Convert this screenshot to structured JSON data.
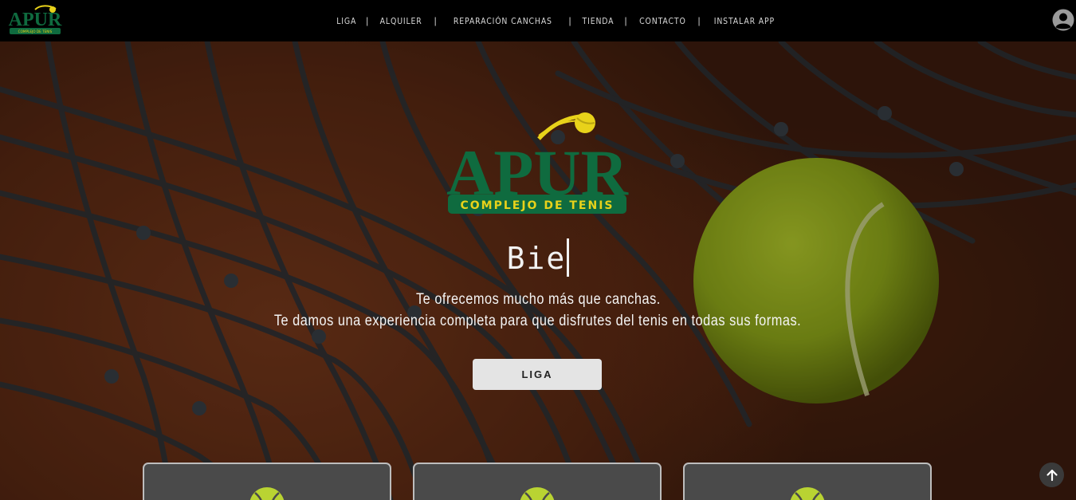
{
  "header": {
    "logo_text": "APUR",
    "logo_subtext": "COMPLEJO DE TENIS",
    "nav": [
      {
        "label": "LIGA"
      },
      {
        "label": "ALQUILER"
      },
      {
        "label": "REPARACIÓN CANCHAS"
      },
      {
        "label": "TIENDA"
      },
      {
        "label": "CONTACTO"
      },
      {
        "label": "INSTALAR APP"
      }
    ],
    "separator": "|",
    "user_icon": "user-circle-icon"
  },
  "hero": {
    "logo_text": "APUR",
    "logo_subtext": "COMPLEJO DE TENIS",
    "typed_text": "Bie",
    "tagline_1": "Te ofrecemos mucho más que canchas.",
    "tagline_2": "Te damos una experiencia completa para que disfrutes del tenis en todas sus formas.",
    "cta_label": "LIGA"
  },
  "cards": [
    {
      "icon": "tennis-ball-icon"
    },
    {
      "icon": "tennis-ball-icon"
    },
    {
      "icon": "tennis-ball-icon"
    }
  ],
  "scroll_top_icon": "arrow-up-icon",
  "colors": {
    "brand_green": "#0f6b3f",
    "brand_yellow": "#e8d21a",
    "header_bg": "#000000",
    "button_bg": "#e4e4e4"
  }
}
